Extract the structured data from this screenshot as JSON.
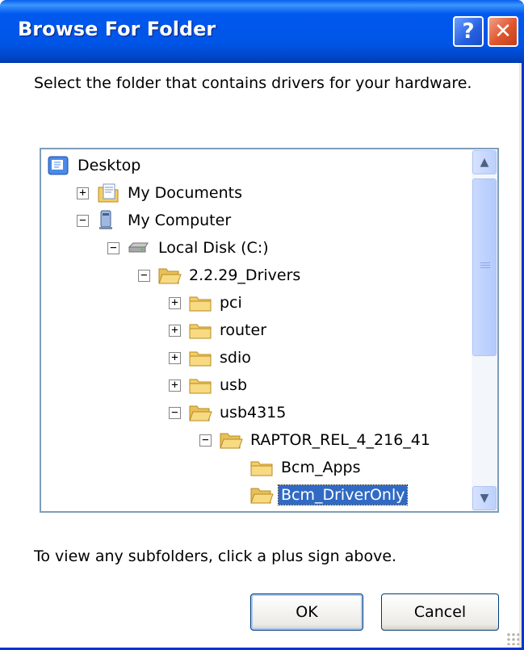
{
  "window": {
    "title": "Browse For Folder",
    "help_glyph": "?",
    "close_glyph": "✕"
  },
  "instruction": "Select the folder that contains drivers for your hardware.",
  "tree": {
    "nodes": [
      {
        "label": "Desktop",
        "icon": "desktop-icon",
        "expander": ""
      },
      {
        "label": "My Documents",
        "icon": "my-documents-icon",
        "expander": "+"
      },
      {
        "label": "My Computer",
        "icon": "my-computer-icon",
        "expander": "−"
      },
      {
        "label": "Local Disk (C:)",
        "icon": "disk-drive-icon",
        "expander": "−"
      },
      {
        "label": "2.2.29_Drivers",
        "icon": "folder-open-icon",
        "expander": "−"
      },
      {
        "label": "pci",
        "icon": "folder-icon",
        "expander": "+"
      },
      {
        "label": "router",
        "icon": "folder-icon",
        "expander": "+"
      },
      {
        "label": "sdio",
        "icon": "folder-icon",
        "expander": "+"
      },
      {
        "label": "usb",
        "icon": "folder-icon",
        "expander": "+"
      },
      {
        "label": "usb4315",
        "icon": "folder-open-icon",
        "expander": "−"
      },
      {
        "label": "RAPTOR_REL_4_216_41",
        "icon": "folder-open-icon",
        "expander": "−"
      },
      {
        "label": "Bcm_Apps",
        "icon": "folder-icon",
        "expander": ""
      },
      {
        "label": "Bcm_DriverOnly",
        "icon": "folder-open-icon",
        "expander": "",
        "selected": true
      }
    ],
    "scroll_up": "▲",
    "scroll_down": "▼"
  },
  "hint": "To view any subfolders, click a plus sign above.",
  "buttons": {
    "ok": "OK",
    "cancel": "Cancel"
  },
  "colors": {
    "title_bar": "#0055E6",
    "selection": "#316AC5",
    "dialog_bg": "#ECE9D8",
    "folder": "#F3CE64"
  }
}
